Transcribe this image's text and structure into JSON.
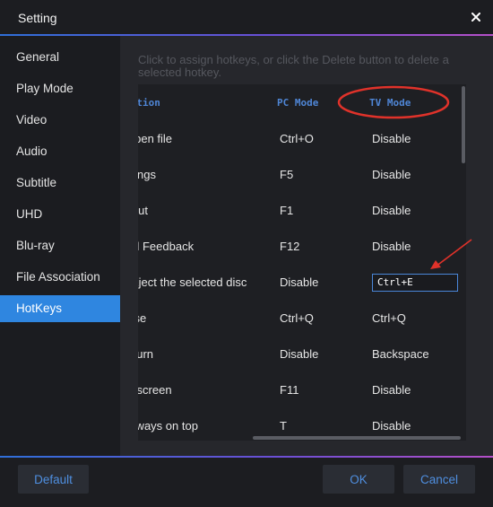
{
  "window": {
    "title": "Setting"
  },
  "sidebar": {
    "items": [
      {
        "label": "General"
      },
      {
        "label": "Play Mode"
      },
      {
        "label": "Video"
      },
      {
        "label": "Audio"
      },
      {
        "label": "Subtitle"
      },
      {
        "label": "UHD"
      },
      {
        "label": "Blu-ray"
      },
      {
        "label": "File Association"
      },
      {
        "label": "HotKeys",
        "active": true
      }
    ]
  },
  "hotkeys": {
    "hint": "Click to assign hotkeys, or click the Delete button to delete a selected hotkey.",
    "columns": {
      "description": "Description",
      "pc": "PC Mode",
      "tv": "TV Mode"
    },
    "rows": [
      {
        "description": "Open file",
        "pc": "Ctrl+O",
        "tv": "Disable"
      },
      {
        "description": "Settings",
        "pc": "F5",
        "tv": "Disable"
      },
      {
        "description": "About",
        "pc": "F1",
        "tv": "Disable"
      },
      {
        "description": "Send Feedback",
        "pc": "F12",
        "tv": "Disable"
      },
      {
        "description": "Eject the selected disc",
        "pc": "Disable",
        "tv": "Ctrl+E",
        "editing": true
      },
      {
        "description": "Close",
        "pc": "Ctrl+Q",
        "tv": "Ctrl+Q"
      },
      {
        "description": "Return",
        "pc": "Disable",
        "tv": "Backspace"
      },
      {
        "description": "Full screen",
        "pc": "F11",
        "tv": "Disable"
      },
      {
        "description": "Always on top",
        "pc": "T",
        "tv": "Disable"
      }
    ]
  },
  "buttons": {
    "default": "Default",
    "ok": "OK",
    "cancel": "Cancel"
  },
  "colors": {
    "accent": "#2f86e0",
    "header_text": "#4f86d6",
    "annotation": "#e0322a"
  },
  "icons": {
    "close": "close-icon"
  }
}
